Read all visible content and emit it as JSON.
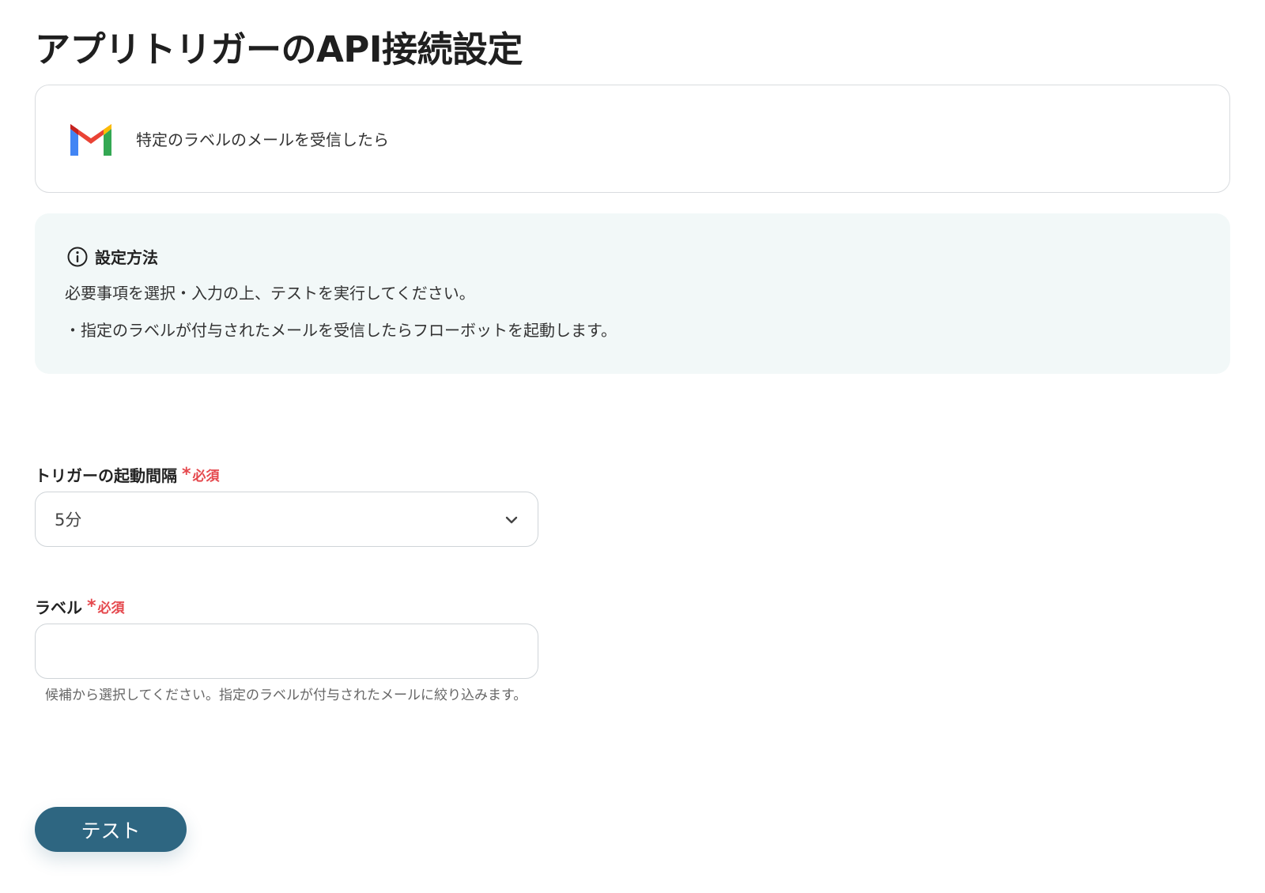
{
  "page": {
    "title": "アプリトリガーのAPI接続設定"
  },
  "trigger": {
    "icon": "gmail-icon",
    "text": "特定のラベルのメールを受信したら"
  },
  "info": {
    "icon": "info-icon",
    "title": "設定方法",
    "line1": "必要事項を選択・入力の上、テストを実行してください。",
    "line2": "・指定のラベルが付与されたメールを受信したらフローボットを起動します。"
  },
  "fields": {
    "interval": {
      "label": "トリガーの起動間隔",
      "required_mark": "*",
      "required_text": "必須",
      "value": "5分",
      "icon": "chevron-down-icon"
    },
    "label": {
      "label": "ラベル",
      "required_mark": "*",
      "required_text": "必須",
      "value": "",
      "help": "候補から選択してください。指定のラベルが付与されたメールに絞り込みます。"
    }
  },
  "actions": {
    "test_label": "テスト"
  },
  "colors": {
    "primary_button": "#2e6681",
    "required": "#e5484d",
    "info_background": "#f2f8f8"
  }
}
